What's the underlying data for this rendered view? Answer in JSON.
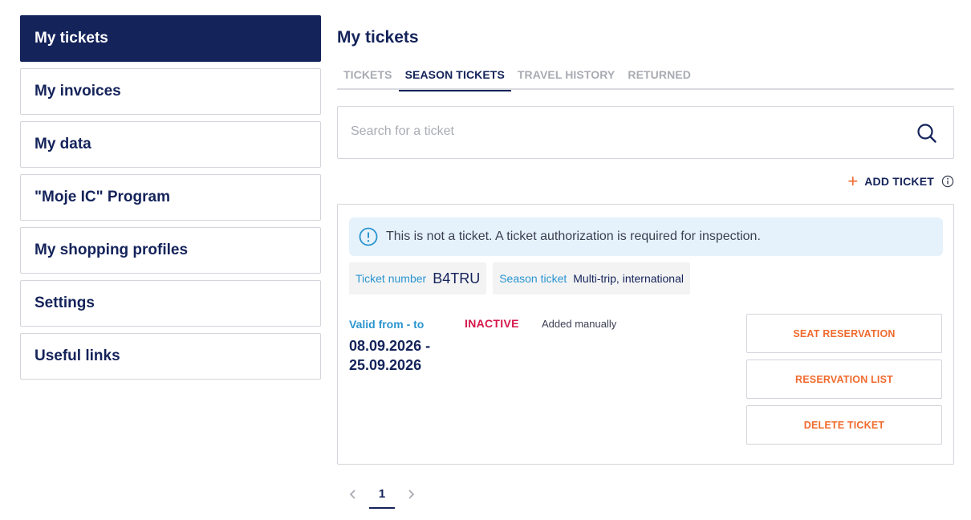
{
  "sidebar": {
    "items": [
      {
        "label": "My tickets",
        "active": true
      },
      {
        "label": "My invoices"
      },
      {
        "label": "My data"
      },
      {
        "label": "\"Moje IC\" Program"
      },
      {
        "label": "My shopping profiles"
      },
      {
        "label": "Settings"
      },
      {
        "label": "Useful links"
      }
    ]
  },
  "main": {
    "title": "My tickets",
    "tabs": [
      {
        "label": "TICKETS"
      },
      {
        "label": "SEASON TICKETS",
        "active": true
      },
      {
        "label": "TRAVEL HISTORY"
      },
      {
        "label": "RETURNED"
      }
    ],
    "search": {
      "placeholder": "Search for a ticket",
      "value": ""
    },
    "add_ticket": {
      "label": "ADD TICKET",
      "plus": "+"
    },
    "ticket": {
      "notice": "This is not a ticket. A ticket authorization is required for inspection.",
      "ticket_number_label": "Ticket number",
      "ticket_number_value": "B4TRU",
      "season_ticket_label": "Season ticket",
      "season_ticket_value": "Multi-trip, international",
      "valid_label": "Valid from - to",
      "valid_dates": "08.09.2026 - 25.09.2026",
      "status": "INACTIVE",
      "added": "Added manually",
      "buttons": {
        "seat_reservation": "SEAT RESERVATION",
        "reservation_list": "RESERVATION LIST",
        "delete_ticket": "DELETE TICKET"
      }
    },
    "pagination": {
      "current_page": "1"
    }
  },
  "colors": {
    "navy": "#14235a",
    "accent_orange": "#f06a2d",
    "info_blue": "#2a95cf",
    "status_red": "#d6174a",
    "notice_bg": "#e6f2fb"
  },
  "icons": [
    "search-icon",
    "plus-icon",
    "info-icon",
    "info-circle-icon",
    "chevron-left-icon",
    "chevron-right-icon"
  ]
}
